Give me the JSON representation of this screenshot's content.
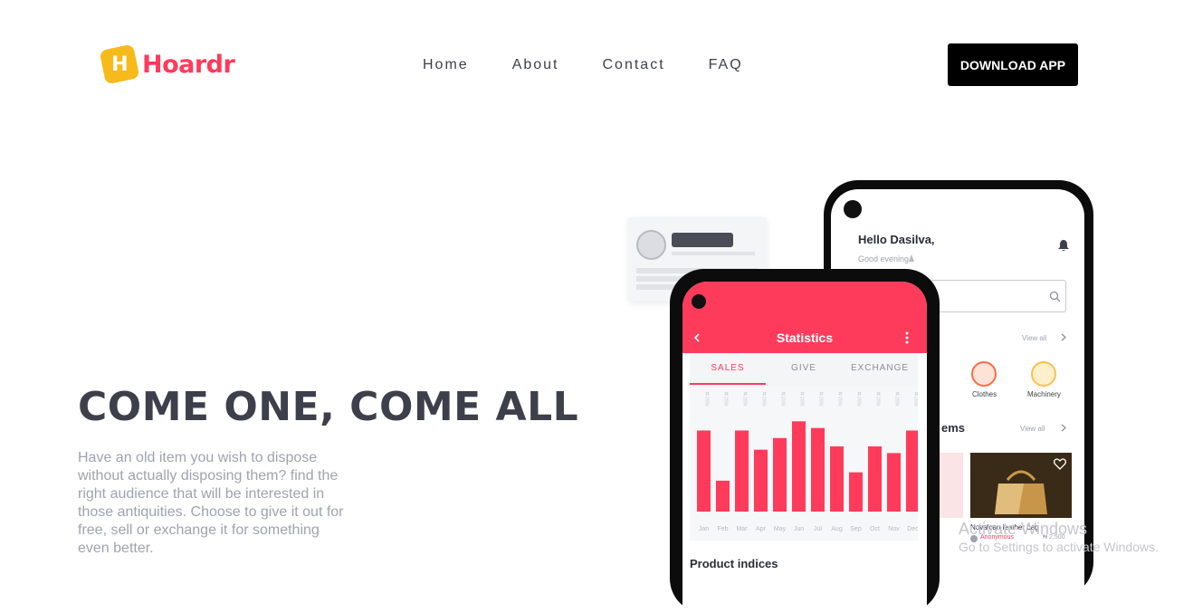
{
  "brand": {
    "badge_letter": "H",
    "name": "Hoardr",
    "color": "#ff3b5c",
    "badge_color": "#f6bb1b"
  },
  "nav": {
    "items": [
      "Home",
      "About",
      "Contact",
      "FAQ"
    ]
  },
  "download_label": "DOWNLOAD APP",
  "hero": {
    "title": "COME ONE, COME ALL",
    "text": "Have an old item you wish to dispose without actually disposing them? find the right audience that will be interested in those antiquities. Choose to give it out for free, sell or exchange it for something even better."
  },
  "back_phone": {
    "greeting": "Hello Dasilva,",
    "subgreeting": "Good evening",
    "view_all_1": "View all",
    "categories": [
      "Clothes",
      "Machinery"
    ],
    "items_heading": "ems",
    "view_all_2": "View all",
    "product_name": "Novalcan leather bag",
    "seller": "Anonymous",
    "price": "₦ 2,500"
  },
  "front_phone": {
    "title": "Statistics",
    "tabs": [
      "SALES",
      "GIVE",
      "EXCHANGE"
    ],
    "product_indices": "Product indices"
  },
  "chart_data": {
    "type": "bar",
    "categories": [
      "Jan",
      "Feb",
      "Mar",
      "Apr",
      "May",
      "Jun",
      "Jul",
      "Aug",
      "Sep",
      "Oct",
      "Nov",
      "Dec"
    ],
    "values": [
      97,
      37,
      97,
      74,
      88,
      108,
      100,
      78,
      47,
      78,
      70,
      97
    ],
    "top_label": "₦ 200k",
    "ylim": [
      0,
      130
    ],
    "color": "#ff3b5c"
  },
  "watermark": {
    "line1": "Activate Windows",
    "line2": "Go to Settings to activate Windows."
  }
}
